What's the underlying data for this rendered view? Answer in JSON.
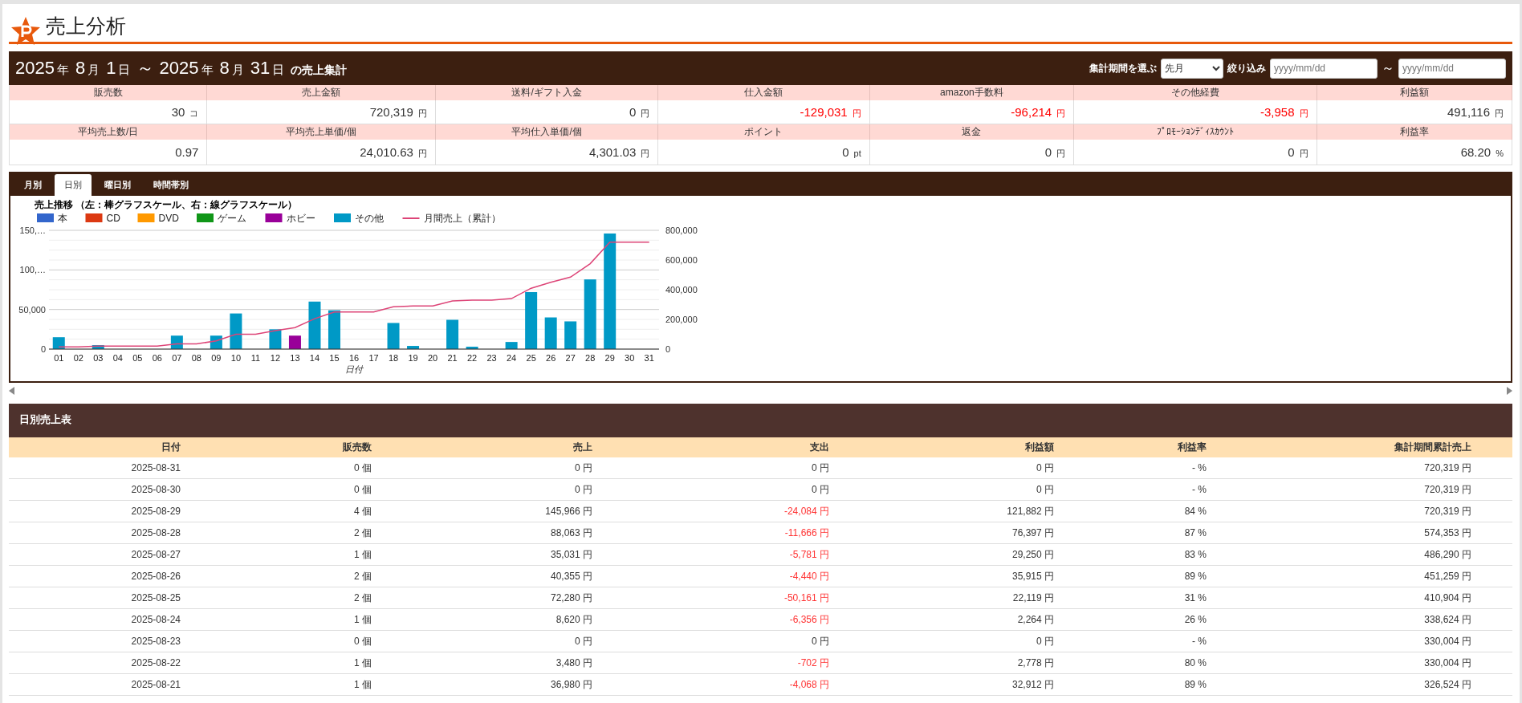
{
  "page_title": "売上分析",
  "period_bar": {
    "title_parts": [
      {
        "kind": "number",
        "text": "2025"
      },
      {
        "kind": "unit",
        "text": "年"
      },
      {
        "kind": "number",
        "text": "8"
      },
      {
        "kind": "unit",
        "text": "月"
      },
      {
        "kind": "number",
        "text": "1"
      },
      {
        "kind": "unit",
        "text": "日"
      },
      {
        "kind": "number",
        "text": "～ 2025"
      },
      {
        "kind": "unit",
        "text": "年"
      },
      {
        "kind": "number",
        "text": "8"
      },
      {
        "kind": "unit",
        "text": "月"
      },
      {
        "kind": "number",
        "text": "31"
      },
      {
        "kind": "unit",
        "text": "日"
      },
      {
        "kind": "suffix",
        "text": "の売上集計"
      }
    ],
    "period_label": "集計期間を選ぶ",
    "period_value": "先月",
    "filter_label": "絞り込み",
    "date_from": {
      "placeholder": "yyyy/mm/dd"
    },
    "range_separator": "～",
    "date_to": {
      "placeholder": "yyyy/mm/dd"
    }
  },
  "summary_rows": [
    {
      "cells": [
        {
          "label": "販売数",
          "value": "30",
          "unit": "コ",
          "negative": false
        },
        {
          "label": "売上金額",
          "value": "720,319",
          "unit": "円",
          "negative": false
        },
        {
          "label": "送料/ギフト入金",
          "value": "0",
          "unit": "円",
          "negative": false
        },
        {
          "label": "仕入金額",
          "value": "-129,031",
          "unit": "円",
          "negative": true
        },
        {
          "label": "amazon手数料",
          "value": "-96,214",
          "unit": "円",
          "negative": true
        },
        {
          "label": "その他経費",
          "value": "-3,958",
          "unit": "円",
          "negative": true
        },
        {
          "label": "利益額",
          "value": "491,116",
          "unit": "円",
          "negative": false
        }
      ]
    },
    {
      "cells": [
        {
          "label": "平均売上数/日",
          "value": "0.97",
          "negative": false
        },
        {
          "label": "平均売上単価/個",
          "value": "24,010.63",
          "unit": "円",
          "negative": false
        },
        {
          "label": "平均仕入単価/個",
          "value": "4,301.03",
          "unit": "円",
          "negative": false
        },
        {
          "label": "ポイント",
          "value": "0",
          "unit": "pt",
          "negative": false
        },
        {
          "label": "返金",
          "value": "0",
          "unit": "円",
          "negative": false
        },
        {
          "label": "ﾌﾟﾛﾓｰｼｮﾝﾃﾞｨｽｶｳﾝﾄ",
          "value": "0",
          "unit": "円",
          "negative": false
        },
        {
          "label": "利益率",
          "value": "68.20",
          "unit": "%",
          "negative": false
        }
      ]
    }
  ],
  "chart_tabs": [
    {
      "label": "月別",
      "selected": false
    },
    {
      "label": "日別",
      "selected": true
    },
    {
      "label": "曜日別",
      "selected": false
    },
    {
      "label": "時間帯別",
      "selected": false
    }
  ],
  "chart": {
    "title": "売上推移 （左：棒グラフスケール、右：線グラフスケール）",
    "bar_layer": {
      "chart_data": {
        "type": "bar",
        "legend": "top",
        "xlabel": "日付",
        "stacked": true,
        "categories": [
          "01",
          "02",
          "03",
          "04",
          "05",
          "06",
          "07",
          "08",
          "09",
          "10",
          "11",
          "12",
          "13",
          "14",
          "15",
          "16",
          "17",
          "18",
          "19",
          "20",
          "21",
          "22",
          "23",
          "24",
          "25",
          "26",
          "27",
          "28",
          "29",
          "30",
          "31"
        ],
        "ylim": [
          0,
          150000
        ],
        "yticks": [
          0,
          {
            "value": 50000,
            "label": "50,000"
          },
          {
            "value": 100000,
            "label": "100,…"
          },
          {
            "value": 150000,
            "label": "150,…"
          }
        ],
        "series": [
          {
            "name": "本",
            "color": "#3366cc",
            "values": [
              0,
              0,
              0,
              0,
              0,
              0,
              0,
              0,
              0,
              0,
              0,
              0,
              0,
              0,
              0,
              0,
              0,
              0,
              0,
              0,
              0,
              0,
              0,
              0,
              0,
              0,
              0,
              0,
              0,
              0,
              0
            ]
          },
          {
            "name": "CD",
            "color": "#dc3912",
            "values": [
              0,
              0,
              0,
              0,
              0,
              0,
              0,
              0,
              0,
              0,
              0,
              0,
              0,
              0,
              0,
              0,
              0,
              0,
              0,
              0,
              0,
              0,
              0,
              0,
              0,
              0,
              0,
              0,
              0,
              0,
              0
            ]
          },
          {
            "name": "DVD",
            "color": "#ff9900",
            "values": [
              0,
              0,
              0,
              0,
              0,
              0,
              0,
              0,
              0,
              0,
              0,
              0,
              0,
              0,
              0,
              0,
              0,
              0,
              0,
              0,
              0,
              0,
              0,
              0,
              0,
              0,
              0,
              0,
              0,
              0,
              0
            ]
          },
          {
            "name": "ゲーム",
            "color": "#109618",
            "values": [
              0,
              0,
              0,
              0,
              0,
              0,
              0,
              0,
              0,
              0,
              0,
              0,
              0,
              0,
              0,
              0,
              0,
              0,
              0,
              0,
              0,
              0,
              0,
              0,
              0,
              0,
              0,
              0,
              0,
              0,
              0
            ]
          },
          {
            "name": "ホビー",
            "color": "#990099",
            "values": [
              0,
              0,
              0,
              0,
              0,
              0,
              0,
              0,
              0,
              0,
              0,
              0,
              17000,
              0,
              0,
              0,
              0,
              0,
              0,
              0,
              0,
              0,
              0,
              0,
              0,
              0,
              0,
              0,
              0,
              0,
              0
            ]
          },
          {
            "name": "その他",
            "color": "#0099c6",
            "values": [
              15000,
              0,
              5000,
              0,
              0,
              0,
              17000,
              0,
              17000,
              45000,
              0,
              25000,
              0,
              60000,
              49000,
              0,
              0,
              33000,
              4000,
              0,
              37000,
              3000,
              0,
              9000,
              72000,
              40000,
              35000,
              88000,
              146000,
              0,
              0
            ]
          }
        ]
      }
    },
    "line_layer": {
      "chart_data": {
        "type": "line",
        "ylim": [
          0,
          800000
        ],
        "yticks": [
          0,
          {
            "value": 200000,
            "label": "200,000"
          },
          {
            "value": 400000,
            "label": "400,000"
          },
          {
            "value": 600000,
            "label": "600,000"
          },
          {
            "value": 800000,
            "label": "800,000"
          }
        ],
        "series": [
          {
            "name": "月間売上（累計）",
            "color": "#dd4477",
            "values": [
              15000,
              15000,
              20000,
              20000,
              20000,
              20000,
              35000,
              35000,
              55000,
              100000,
              100000,
              125000,
              145000,
              205000,
              250000,
              250000,
              250000,
              285000,
              290000,
              290000,
              325000,
              330000,
              330000,
              340000,
              410000,
              450000,
              485000,
              575000,
              720000,
              720000,
              720000
            ]
          }
        ]
      }
    }
  },
  "daily_table": {
    "title": "日別売上表",
    "columns": [
      "日付",
      "販売数",
      "売上",
      "支出",
      "利益額",
      "利益率",
      "集計期間累計売上"
    ],
    "rows": [
      {
        "cells": [
          "2025-08-31",
          "0 個",
          "0 円",
          "0 円",
          "0 円",
          "- %",
          "720,319 円"
        ],
        "expense_negative": false
      },
      {
        "cells": [
          "2025-08-30",
          "0 個",
          "0 円",
          "0 円",
          "0 円",
          "- %",
          "720,319 円"
        ],
        "expense_negative": false
      },
      {
        "cells": [
          "2025-08-29",
          "4 個",
          "145,966 円",
          "-24,084 円",
          "121,882 円",
          "84 %",
          "720,319 円"
        ],
        "expense_negative": true
      },
      {
        "cells": [
          "2025-08-28",
          "2 個",
          "88,063 円",
          "-11,666 円",
          "76,397 円",
          "87 %",
          "574,353 円"
        ],
        "expense_negative": true
      },
      {
        "cells": [
          "2025-08-27",
          "1 個",
          "35,031 円",
          "-5,781 円",
          "29,250 円",
          "83 %",
          "486,290 円"
        ],
        "expense_negative": true
      },
      {
        "cells": [
          "2025-08-26",
          "2 個",
          "40,355 円",
          "-4,440 円",
          "35,915 円",
          "89 %",
          "451,259 円"
        ],
        "expense_negative": true
      },
      {
        "cells": [
          "2025-08-25",
          "2 個",
          "72,280 円",
          "-50,161 円",
          "22,119 円",
          "31 %",
          "410,904 円"
        ],
        "expense_negative": true
      },
      {
        "cells": [
          "2025-08-24",
          "1 個",
          "8,620 円",
          "-6,356 円",
          "2,264 円",
          "26 %",
          "338,624 円"
        ],
        "expense_negative": true
      },
      {
        "cells": [
          "2025-08-23",
          "0 個",
          "0 円",
          "0 円",
          "0 円",
          "- %",
          "330,004 円"
        ],
        "expense_negative": false
      },
      {
        "cells": [
          "2025-08-22",
          "1 個",
          "3,480 円",
          "-702 円",
          "2,778 円",
          "80 %",
          "330,004 円"
        ],
        "expense_negative": true
      },
      {
        "cells": [
          "2025-08-21",
          "1 個",
          "36,980 円",
          "-4,068 円",
          "32,912 円",
          "89 %",
          "326,524 円"
        ],
        "expense_negative": true
      }
    ]
  }
}
